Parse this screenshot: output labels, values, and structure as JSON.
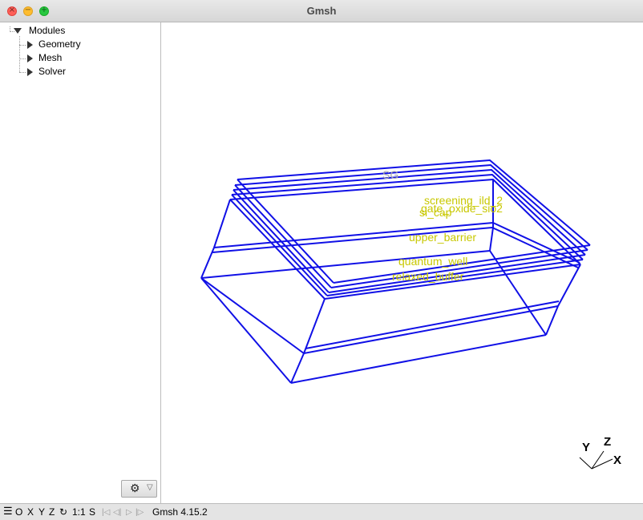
{
  "window": {
    "title": "Gmsh"
  },
  "tree": {
    "root": "Modules",
    "children": [
      "Geometry",
      "Mesh",
      "Solver"
    ]
  },
  "controls": {
    "gear_icon": "gear-icon",
    "dropdown_icon": "triangle-down-icon"
  },
  "labels": {
    "top": "SG",
    "screening": "screening_ild_2",
    "gate": "gate_oxide_sio2",
    "si_cap": "si_cap",
    "upper": "upper_barrier",
    "quantum": "quantum_well",
    "relaxed": "relaxed_buffer"
  },
  "axes": {
    "x": "X",
    "y": "Y",
    "z": "Z"
  },
  "statusbar": {
    "menu_icon": "hamburger-icon",
    "o": "O",
    "x": "X",
    "y": "Y",
    "z": "Z",
    "rotate": "↻",
    "ratio": "1:1",
    "s": "S",
    "first": "|◁",
    "prev": "◁|",
    "play": "▷",
    "last": "|▷",
    "version": "Gmsh 4.15.2"
  },
  "colors": {
    "wire": "#1010e6",
    "label": "#c8c800",
    "label_gray": "#a6a6a6"
  }
}
